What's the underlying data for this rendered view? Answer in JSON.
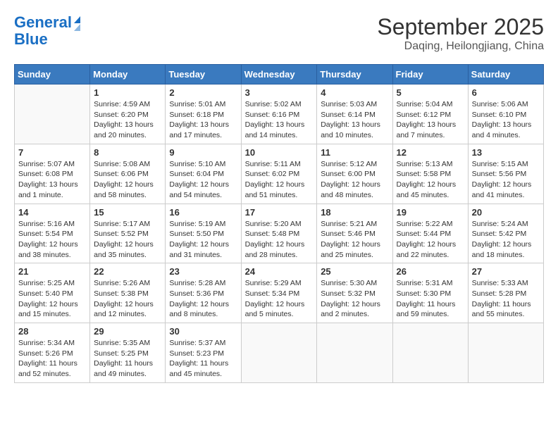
{
  "logo": {
    "line1": "General",
    "line2": "Blue"
  },
  "title": "September 2025",
  "subtitle": "Daqing, Heilongjiang, China",
  "days_of_week": [
    "Sunday",
    "Monday",
    "Tuesday",
    "Wednesday",
    "Thursday",
    "Friday",
    "Saturday"
  ],
  "weeks": [
    [
      {
        "day": "",
        "info": ""
      },
      {
        "day": "1",
        "info": "Sunrise: 4:59 AM\nSunset: 6:20 PM\nDaylight: 13 hours\nand 20 minutes."
      },
      {
        "day": "2",
        "info": "Sunrise: 5:01 AM\nSunset: 6:18 PM\nDaylight: 13 hours\nand 17 minutes."
      },
      {
        "day": "3",
        "info": "Sunrise: 5:02 AM\nSunset: 6:16 PM\nDaylight: 13 hours\nand 14 minutes."
      },
      {
        "day": "4",
        "info": "Sunrise: 5:03 AM\nSunset: 6:14 PM\nDaylight: 13 hours\nand 10 minutes."
      },
      {
        "day": "5",
        "info": "Sunrise: 5:04 AM\nSunset: 6:12 PM\nDaylight: 13 hours\nand 7 minutes."
      },
      {
        "day": "6",
        "info": "Sunrise: 5:06 AM\nSunset: 6:10 PM\nDaylight: 13 hours\nand 4 minutes."
      }
    ],
    [
      {
        "day": "7",
        "info": "Sunrise: 5:07 AM\nSunset: 6:08 PM\nDaylight: 13 hours\nand 1 minute."
      },
      {
        "day": "8",
        "info": "Sunrise: 5:08 AM\nSunset: 6:06 PM\nDaylight: 12 hours\nand 58 minutes."
      },
      {
        "day": "9",
        "info": "Sunrise: 5:10 AM\nSunset: 6:04 PM\nDaylight: 12 hours\nand 54 minutes."
      },
      {
        "day": "10",
        "info": "Sunrise: 5:11 AM\nSunset: 6:02 PM\nDaylight: 12 hours\nand 51 minutes."
      },
      {
        "day": "11",
        "info": "Sunrise: 5:12 AM\nSunset: 6:00 PM\nDaylight: 12 hours\nand 48 minutes."
      },
      {
        "day": "12",
        "info": "Sunrise: 5:13 AM\nSunset: 5:58 PM\nDaylight: 12 hours\nand 45 minutes."
      },
      {
        "day": "13",
        "info": "Sunrise: 5:15 AM\nSunset: 5:56 PM\nDaylight: 12 hours\nand 41 minutes."
      }
    ],
    [
      {
        "day": "14",
        "info": "Sunrise: 5:16 AM\nSunset: 5:54 PM\nDaylight: 12 hours\nand 38 minutes."
      },
      {
        "day": "15",
        "info": "Sunrise: 5:17 AM\nSunset: 5:52 PM\nDaylight: 12 hours\nand 35 minutes."
      },
      {
        "day": "16",
        "info": "Sunrise: 5:19 AM\nSunset: 5:50 PM\nDaylight: 12 hours\nand 31 minutes."
      },
      {
        "day": "17",
        "info": "Sunrise: 5:20 AM\nSunset: 5:48 PM\nDaylight: 12 hours\nand 28 minutes."
      },
      {
        "day": "18",
        "info": "Sunrise: 5:21 AM\nSunset: 5:46 PM\nDaylight: 12 hours\nand 25 minutes."
      },
      {
        "day": "19",
        "info": "Sunrise: 5:22 AM\nSunset: 5:44 PM\nDaylight: 12 hours\nand 22 minutes."
      },
      {
        "day": "20",
        "info": "Sunrise: 5:24 AM\nSunset: 5:42 PM\nDaylight: 12 hours\nand 18 minutes."
      }
    ],
    [
      {
        "day": "21",
        "info": "Sunrise: 5:25 AM\nSunset: 5:40 PM\nDaylight: 12 hours\nand 15 minutes."
      },
      {
        "day": "22",
        "info": "Sunrise: 5:26 AM\nSunset: 5:38 PM\nDaylight: 12 hours\nand 12 minutes."
      },
      {
        "day": "23",
        "info": "Sunrise: 5:28 AM\nSunset: 5:36 PM\nDaylight: 12 hours\nand 8 minutes."
      },
      {
        "day": "24",
        "info": "Sunrise: 5:29 AM\nSunset: 5:34 PM\nDaylight: 12 hours\nand 5 minutes."
      },
      {
        "day": "25",
        "info": "Sunrise: 5:30 AM\nSunset: 5:32 PM\nDaylight: 12 hours\nand 2 minutes."
      },
      {
        "day": "26",
        "info": "Sunrise: 5:31 AM\nSunset: 5:30 PM\nDaylight: 11 hours\nand 59 minutes."
      },
      {
        "day": "27",
        "info": "Sunrise: 5:33 AM\nSunset: 5:28 PM\nDaylight: 11 hours\nand 55 minutes."
      }
    ],
    [
      {
        "day": "28",
        "info": "Sunrise: 5:34 AM\nSunset: 5:26 PM\nDaylight: 11 hours\nand 52 minutes."
      },
      {
        "day": "29",
        "info": "Sunrise: 5:35 AM\nSunset: 5:25 PM\nDaylight: 11 hours\nand 49 minutes."
      },
      {
        "day": "30",
        "info": "Sunrise: 5:37 AM\nSunset: 5:23 PM\nDaylight: 11 hours\nand 45 minutes."
      },
      {
        "day": "",
        "info": ""
      },
      {
        "day": "",
        "info": ""
      },
      {
        "day": "",
        "info": ""
      },
      {
        "day": "",
        "info": ""
      }
    ]
  ]
}
